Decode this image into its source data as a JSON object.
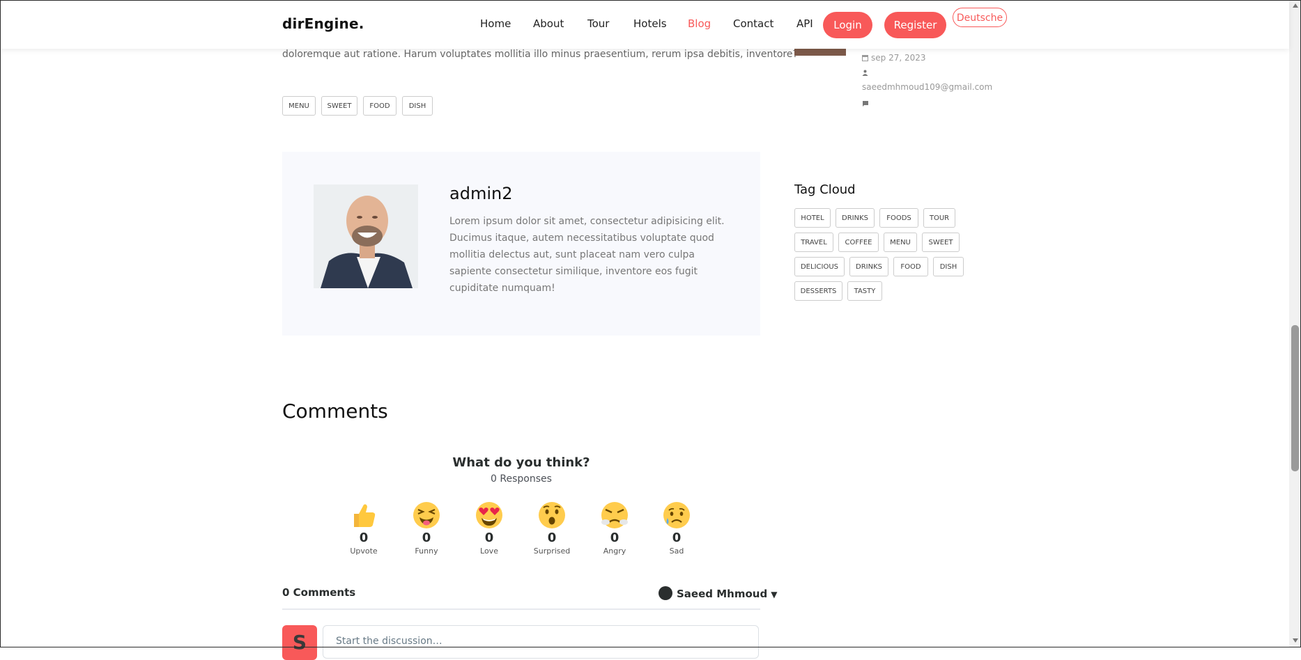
{
  "navbar": {
    "brand": "dirEngine.",
    "links": [
      "Home",
      "About",
      "Tour",
      "Hotels",
      "Blog",
      "Contact",
      "API"
    ],
    "login": "Login",
    "register": "Register",
    "language": "Deutsche",
    "accent_color": "#f85959"
  },
  "post": {
    "text_tail": "doloremque aut ratione. Harum voluptates mollitia illo minus praesentium, rerum ipsa debitis, inventore?",
    "tags": [
      "MENU",
      "SWEET",
      "FOOD",
      "DISH"
    ]
  },
  "author": {
    "name": "admin2",
    "bio": "Lorem ipsum dolor sit amet, consectetur adipisicing elit. Ducimus itaque, autem necessitatibus voluptate quod mollitia delectus aut, sunt placeat nam vero culpa sapiente consectetur similique, inventore eos fugit cupiditate numquam!"
  },
  "comments": {
    "title": "Comments",
    "question": "What do you think?",
    "responses": "0 Responses",
    "reactions": [
      {
        "label": "Upvote",
        "count": "0",
        "icon": "thumbs-up-icon"
      },
      {
        "label": "Funny",
        "count": "0",
        "icon": "laughing-face-icon"
      },
      {
        "label": "Love",
        "count": "0",
        "icon": "heart-eyes-face-icon"
      },
      {
        "label": "Surprised",
        "count": "0",
        "icon": "surprised-face-icon"
      },
      {
        "label": "Angry",
        "count": "0",
        "icon": "angry-face-icon"
      },
      {
        "label": "Sad",
        "count": "0",
        "icon": "sad-face-icon"
      }
    ],
    "count_label": "0 Comments",
    "user": "Saeed Mhmoud",
    "avatar_letter": "S",
    "input_placeholder": "Start the discussion…"
  },
  "sidebar": {
    "recent_post": {
      "date": "sep 27, 2023",
      "author": "saeedmhmoud109@gmail.com"
    },
    "tag_cloud_title": "Tag Cloud",
    "tags": [
      "HOTEL",
      "DRINKS",
      "FOODS",
      "TOUR",
      "TRAVEL",
      "COFFEE",
      "MENU",
      "SWEET",
      "DELICIOUS",
      "DRINKS",
      "FOOD",
      "DISH",
      "DESSERTS",
      "TASTY"
    ]
  }
}
